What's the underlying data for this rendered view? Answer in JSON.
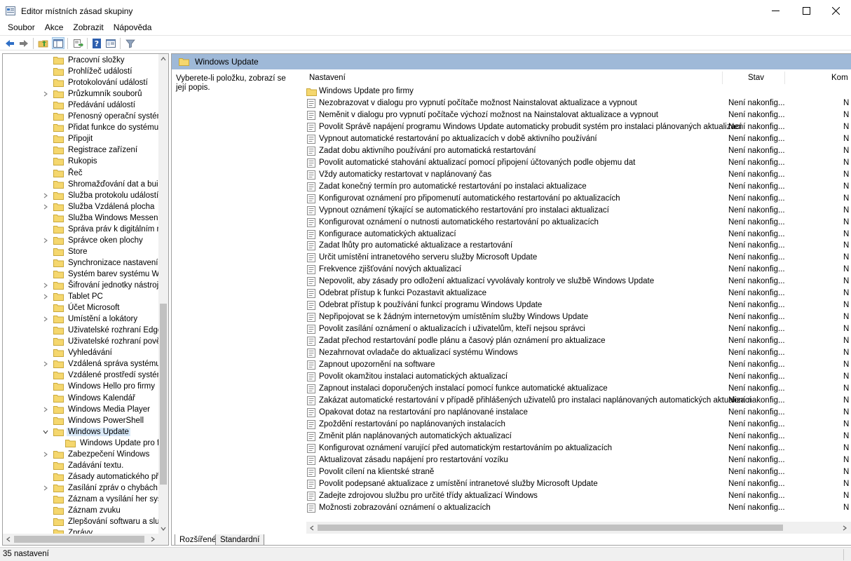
{
  "window": {
    "title": "Editor místních zásad skupiny"
  },
  "menu": [
    "Soubor",
    "Akce",
    "Zobrazit",
    "Nápověda"
  ],
  "toolbar": {
    "icons": [
      "back-arrow-icon",
      "forward-arrow-icon",
      "up-folder-icon",
      "show-hide-tree-icon",
      "export-list-icon",
      "help-icon",
      "properties-icon",
      "filter-icon"
    ]
  },
  "tree": {
    "items": [
      {
        "label": "Pracovní složky",
        "expandable": false,
        "depth": 0
      },
      {
        "label": "Prohlížeč událostí",
        "expandable": false,
        "depth": 0
      },
      {
        "label": "Protokolování událostí",
        "expandable": false,
        "depth": 0
      },
      {
        "label": "Průzkumník souborů",
        "expandable": true,
        "depth": 0
      },
      {
        "label": "Předávání událostí",
        "expandable": false,
        "depth": 0
      },
      {
        "label": "Přenosný operační systém",
        "expandable": false,
        "depth": 0
      },
      {
        "label": "Přidat funkce do systému W",
        "expandable": false,
        "depth": 0
      },
      {
        "label": "Připojit",
        "expandable": false,
        "depth": 0
      },
      {
        "label": "Registrace zařízení",
        "expandable": false,
        "depth": 0
      },
      {
        "label": "Rukopis",
        "expandable": false,
        "depth": 0
      },
      {
        "label": "Řeč",
        "expandable": false,
        "depth": 0
      },
      {
        "label": "Shromažďování dat a buildy",
        "expandable": false,
        "depth": 0
      },
      {
        "label": "Služba protokolu událostí",
        "expandable": true,
        "depth": 0
      },
      {
        "label": "Služba Vzdálená plocha",
        "expandable": true,
        "depth": 0
      },
      {
        "label": "Služba Windows Messenger",
        "expandable": false,
        "depth": 0
      },
      {
        "label": "Správa práv k digitálním mé",
        "expandable": false,
        "depth": 0
      },
      {
        "label": "Správce oken plochy",
        "expandable": true,
        "depth": 0
      },
      {
        "label": "Store",
        "expandable": false,
        "depth": 0
      },
      {
        "label": "Synchronizace nastavení",
        "expandable": false,
        "depth": 0
      },
      {
        "label": "Systém barev systému Wind",
        "expandable": false,
        "depth": 0
      },
      {
        "label": "Šifrování jednotky nástrojem",
        "expandable": true,
        "depth": 0
      },
      {
        "label": "Tablet PC",
        "expandable": true,
        "depth": 0
      },
      {
        "label": "Účet Microsoft",
        "expandable": false,
        "depth": 0
      },
      {
        "label": "Umístění a lokátory",
        "expandable": true,
        "depth": 0
      },
      {
        "label": "Uživatelské rozhraní Edge",
        "expandable": false,
        "depth": 0
      },
      {
        "label": "Uživatelské rozhraní pověřer",
        "expandable": false,
        "depth": 0
      },
      {
        "label": "Vyhledávání",
        "expandable": false,
        "depth": 0
      },
      {
        "label": "Vzdálená správa systému Wi",
        "expandable": true,
        "depth": 0
      },
      {
        "label": "Vzdálené prostředí systému",
        "expandable": false,
        "depth": 0
      },
      {
        "label": "Windows Hello pro firmy",
        "expandable": false,
        "depth": 0
      },
      {
        "label": "Windows Kalendář",
        "expandable": false,
        "depth": 0
      },
      {
        "label": "Windows Media Player",
        "expandable": true,
        "depth": 0
      },
      {
        "label": "Windows PowerShell",
        "expandable": false,
        "depth": 0
      },
      {
        "label": "Windows Update",
        "expandable": true,
        "expanded": true,
        "selected": true,
        "depth": 0
      },
      {
        "label": "Windows Update pro firr",
        "expandable": false,
        "depth": 1
      },
      {
        "label": "Zabezpečení Windows",
        "expandable": true,
        "depth": 0
      },
      {
        "label": "Zadávání textu.",
        "expandable": false,
        "depth": 0
      },
      {
        "label": "Zásady automatického přeh",
        "expandable": false,
        "depth": 0
      },
      {
        "label": "Zasílání zpráv o chybách sys",
        "expandable": true,
        "depth": 0
      },
      {
        "label": "Záznam a vysílání her systér",
        "expandable": false,
        "depth": 0
      },
      {
        "label": "Záznam zvuku",
        "expandable": false,
        "depth": 0
      },
      {
        "label": "Zlepšování softwaru a služeb",
        "expandable": false,
        "depth": 0
      },
      {
        "label": "Zprávy",
        "expandable": false,
        "depth": 0
      }
    ]
  },
  "right": {
    "header_title": "Windows Update",
    "description": "Vyberete-li položku, zobrazí se její popis.",
    "columns": {
      "setting": "Nastavení",
      "state": "Stav",
      "comment": "Kom"
    },
    "folder_row": "Windows Update pro firmy",
    "settings": [
      "Nezobrazovat v dialogu pro vypnutí počítače možnost Nainstalovat aktualizace a vypnout",
      "Neměnit v dialogu pro vypnutí počítače výchozí možnost na Nainstalovat aktualizace a vypnout",
      "Povolit Správě napájení programu Windows Update automaticky probudit systém pro instalaci plánovaných aktualizací",
      "Vypnout automatické restartování po aktualizacích v době aktivního používání",
      "Zadat dobu aktivního používání pro automatická restartování",
      "Povolit automatické stahování aktualizací pomocí připojení účtovaných podle objemu dat",
      "Vždy automaticky restartovat v naplánovaný čas",
      "Zadat konečný termín pro automatické restartování po instalaci aktualizace",
      "Konfigurovat oznámení pro připomenutí automatického restartování po aktualizacích",
      "Vypnout oznámení týkající se automatického restartování pro instalaci aktualizací",
      "Konfigurovat oznámení o nutnosti automatického restartování po aktualizacích",
      "Konfigurace automatických aktualizací",
      "Zadat lhůty pro automatické aktualizace a restartování",
      "Určit umístění intranetového serveru služby Microsoft Update",
      "Frekvence zjišťování nových aktualizací",
      "Nepovolit, aby zásady pro odložení aktualizací vyvolávaly kontroly ve službě Windows Update",
      "Odebrat přístup k funkci Pozastavit aktualizace",
      "Odebrat přístup k používání funkcí programu Windows Update",
      "Nepřipojovat se k žádným internetovým umístěním služby Windows Update",
      "Povolit zasílání oznámení o aktualizacích i uživatelům, kteří nejsou správci",
      "Zadat přechod restartování podle plánu a časový plán oznámení pro aktualizace",
      "Nezahrnovat ovladače do aktualizací systému Windows",
      "Zapnout upozornění na software",
      "Povolit okamžitou instalaci automatických aktualizací",
      "Zapnout instalaci doporučených instalací pomocí funkce automatické aktualizace",
      "Zakázat automatické restartování v případě přihlášených uživatelů pro instalaci naplánovaných automatických aktualizací",
      "Opakovat dotaz na restartování pro naplánované instalace",
      "Zpoždění restartování po naplánovaných instalacích",
      "Změnit plán naplánovaných automatických aktualizací",
      "Konfigurovat oznámení varující před automatickým restartováním po aktualizacích",
      "Aktualizovat zásadu napájení pro restartování vozíku",
      "Povolit cílení na klientské straně",
      "Povolit podepsané aktualizace z umístění intranetové služby Microsoft Update",
      "Zadejte zdrojovou službu pro určité třídy aktualizací Windows",
      "Možnosti zobrazování oznámení o aktualizacích"
    ],
    "state_value": "Není nakonfig...",
    "comment_value": "N",
    "tabs": [
      "Rozšířené",
      "Standardní"
    ]
  },
  "status": {
    "text": "35 nastavení"
  },
  "colors": {
    "header_bar": "#9fb9d8",
    "selection": "#d9e9f8",
    "folder": "#f5d76e"
  }
}
